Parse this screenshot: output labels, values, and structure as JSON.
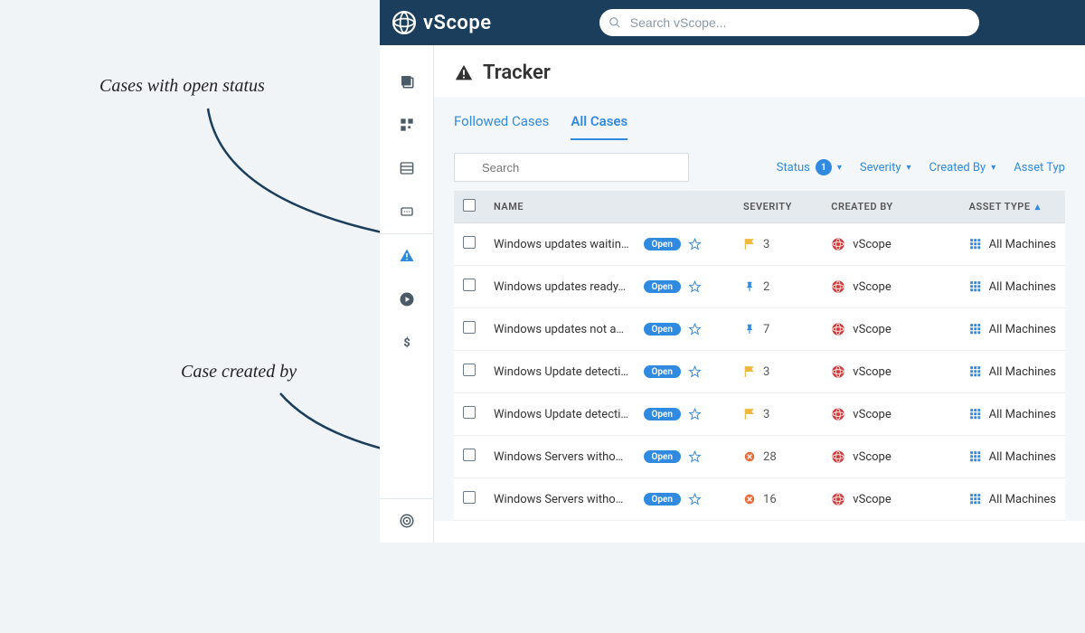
{
  "brand": {
    "name": "vScope"
  },
  "search": {
    "placeholder": "Search vScope..."
  },
  "page": {
    "title": "Tracker"
  },
  "tabs": [
    {
      "label": "Followed Cases",
      "active": false
    },
    {
      "label": "All Cases",
      "active": true
    }
  ],
  "filters": {
    "search_placeholder": "Search",
    "status": {
      "label": "Status",
      "count": "1"
    },
    "severity": {
      "label": "Severity"
    },
    "created_by": {
      "label": "Created By"
    },
    "asset_type": {
      "label": "Asset Typ"
    }
  },
  "columns": {
    "name": "NAME",
    "severity": "SEVERITY",
    "created_by": "CREATED BY",
    "asset_type": "ASSET TYPE"
  },
  "rows": [
    {
      "name": "Windows updates waitin…",
      "status": "Open",
      "sev_icon": "flag",
      "sev_value": "3",
      "creator": "vScope",
      "asset": "All Machines"
    },
    {
      "name": "Windows updates ready…",
      "status": "Open",
      "sev_icon": "pin",
      "sev_value": "2",
      "creator": "vScope",
      "asset": "All Machines"
    },
    {
      "name": "Windows updates not a…",
      "status": "Open",
      "sev_icon": "pin",
      "sev_value": "7",
      "creator": "vScope",
      "asset": "All Machines"
    },
    {
      "name": "Windows Update detecti…",
      "status": "Open",
      "sev_icon": "flag",
      "sev_value": "3",
      "creator": "vScope",
      "asset": "All Machines"
    },
    {
      "name": "Windows Update detecti…",
      "status": "Open",
      "sev_icon": "flag",
      "sev_value": "3",
      "creator": "vScope",
      "asset": "All Machines"
    },
    {
      "name": "Windows Servers witho…",
      "status": "Open",
      "sev_icon": "x",
      "sev_value": "28",
      "creator": "vScope",
      "asset": "All Machines"
    },
    {
      "name": "Windows Servers witho…",
      "status": "Open",
      "sev_icon": "x",
      "sev_value": "16",
      "creator": "vScope",
      "asset": "All Machines"
    }
  ],
  "annotations": {
    "a1": "Cases with open status",
    "a2": "Case created by"
  },
  "icons": {
    "flag_color": "#f0b93e",
    "pin_color": "#2f8ae0",
    "x_color": "#e86b3a",
    "grid_color": "#2f8ae0",
    "vscope_color": "#d43a3a"
  }
}
